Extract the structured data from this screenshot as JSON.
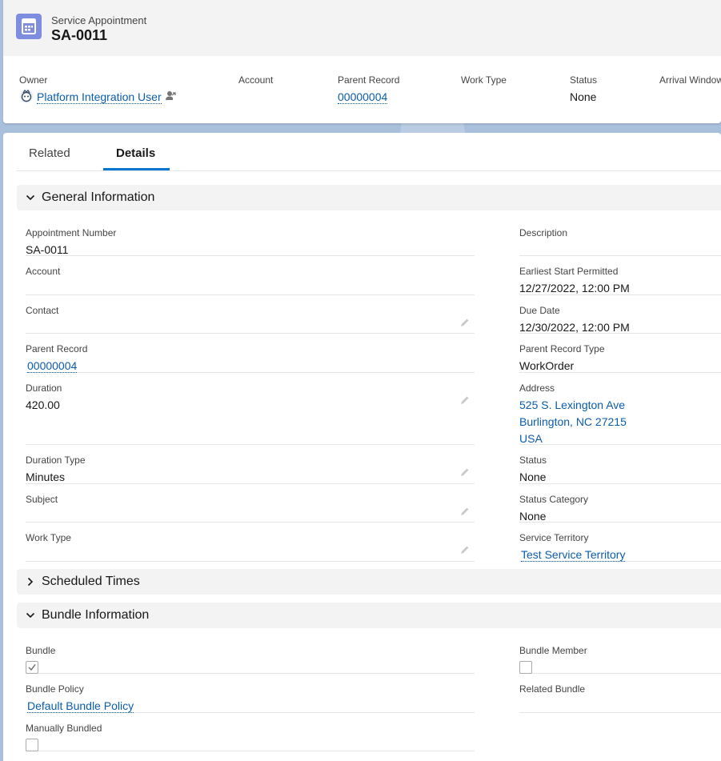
{
  "header": {
    "object_label": "Service Appointment",
    "record_name": "SA-0011",
    "icon": "service-appointment-icon",
    "icon_color": "#7f8de1"
  },
  "highlights": {
    "owner": {
      "label": "Owner",
      "value": "Platform Integration User"
    },
    "account": {
      "label": "Account",
      "value": ""
    },
    "parent_record": {
      "label": "Parent Record",
      "value": "00000004"
    },
    "work_type": {
      "label": "Work Type",
      "value": ""
    },
    "status": {
      "label": "Status",
      "value": "None"
    },
    "arrival_window": {
      "label": "Arrival Window",
      "value": ""
    }
  },
  "tabs": [
    {
      "label": "Related",
      "active": false
    },
    {
      "label": "Details",
      "active": true
    }
  ],
  "sections": {
    "general": {
      "title": "General Information",
      "expanded": true,
      "left": {
        "appointment_number": {
          "label": "Appointment Number",
          "value": "SA-0011"
        },
        "account": {
          "label": "Account",
          "value": ""
        },
        "contact": {
          "label": "Contact",
          "value": ""
        },
        "parent_record": {
          "label": "Parent Record",
          "value": "00000004"
        },
        "duration": {
          "label": "Duration",
          "value": "420.00"
        },
        "duration_type": {
          "label": "Duration Type",
          "value": "Minutes"
        },
        "subject": {
          "label": "Subject",
          "value": ""
        },
        "work_type": {
          "label": "Work Type",
          "value": ""
        }
      },
      "right": {
        "description": {
          "label": "Description",
          "value": ""
        },
        "earliest_start": {
          "label": "Earliest Start Permitted",
          "value": "12/27/2022, 12:00 PM"
        },
        "due_date": {
          "label": "Due Date",
          "value": "12/30/2022, 12:00 PM"
        },
        "parent_record_type": {
          "label": "Parent Record Type",
          "value": "WorkOrder"
        },
        "address": {
          "label": "Address",
          "lines": [
            "525 S. Lexington Ave",
            "Burlington, NC 27215",
            "USA"
          ]
        },
        "status": {
          "label": "Status",
          "value": "None"
        },
        "status_category": {
          "label": "Status Category",
          "value": "None"
        },
        "service_territory": {
          "label": "Service Territory",
          "value": "Test Service Territory"
        }
      }
    },
    "scheduled": {
      "title": "Scheduled Times",
      "expanded": false
    },
    "bundle": {
      "title": "Bundle Information",
      "expanded": true,
      "left": {
        "bundle": {
          "label": "Bundle",
          "checked": true
        },
        "bundle_policy": {
          "label": "Bundle Policy",
          "value": "Default Bundle Policy"
        },
        "manually_bundled": {
          "label": "Manually Bundled",
          "checked": false
        }
      },
      "right": {
        "bundle_member": {
          "label": "Bundle Member",
          "checked": false
        },
        "related_bundle": {
          "label": "Related Bundle",
          "value": ""
        }
      }
    }
  },
  "colors": {
    "link": "#0b5cab",
    "tab_active": "#0176d3"
  }
}
